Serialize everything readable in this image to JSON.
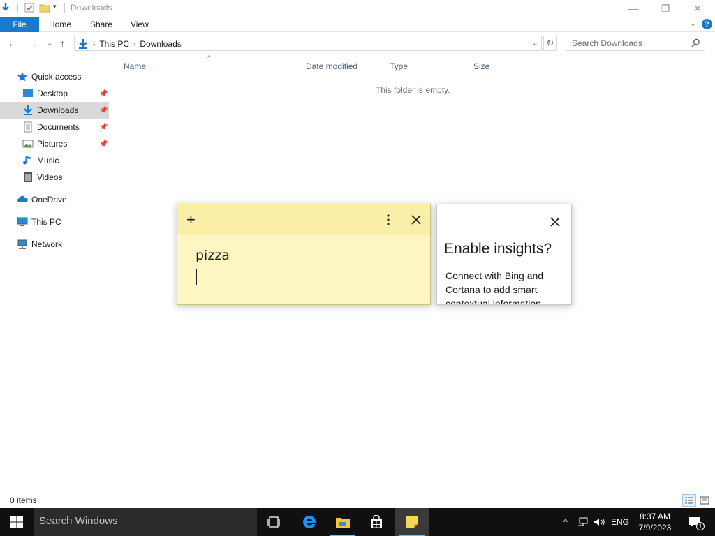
{
  "window": {
    "title": "Downloads",
    "controls": {
      "minimize": "—",
      "restore": "❐",
      "close": "✕"
    }
  },
  "ribbon": {
    "file": "File",
    "tabs": [
      "Home",
      "Share",
      "View"
    ]
  },
  "address": {
    "segments": [
      "This PC",
      "Downloads"
    ],
    "search_placeholder": "Search Downloads"
  },
  "nav": {
    "items": [
      {
        "label": "Quick access",
        "icon": "star-icon"
      },
      {
        "label": "Desktop",
        "icon": "desktop-icon",
        "pinned": true
      },
      {
        "label": "Downloads",
        "icon": "download-icon",
        "pinned": true,
        "selected": true
      },
      {
        "label": "Documents",
        "icon": "documents-icon",
        "pinned": true
      },
      {
        "label": "Pictures",
        "icon": "pictures-icon",
        "pinned": true
      },
      {
        "label": "Music",
        "icon": "music-icon"
      },
      {
        "label": "Videos",
        "icon": "videos-icon"
      },
      {
        "label": "OneDrive",
        "icon": "cloud-icon"
      },
      {
        "label": "This PC",
        "icon": "computer-icon"
      },
      {
        "label": "Network",
        "icon": "network-icon"
      }
    ]
  },
  "content": {
    "columns": [
      "Name",
      "Date modified",
      "Type",
      "Size"
    ],
    "empty_message": "This folder is empty."
  },
  "status": {
    "item_count": "0 items"
  },
  "sticky_note": {
    "text": "pizza",
    "color": "#fdf7c3"
  },
  "insights": {
    "title": "Enable insights?",
    "body": "Connect with Bing and Cortana to add smart contextual information"
  },
  "taskbar": {
    "search_placeholder": "Search Windows",
    "tray": {
      "language": "ENG",
      "time": "8:37 AM",
      "date": "7/9/2023",
      "notifications": "1"
    }
  }
}
